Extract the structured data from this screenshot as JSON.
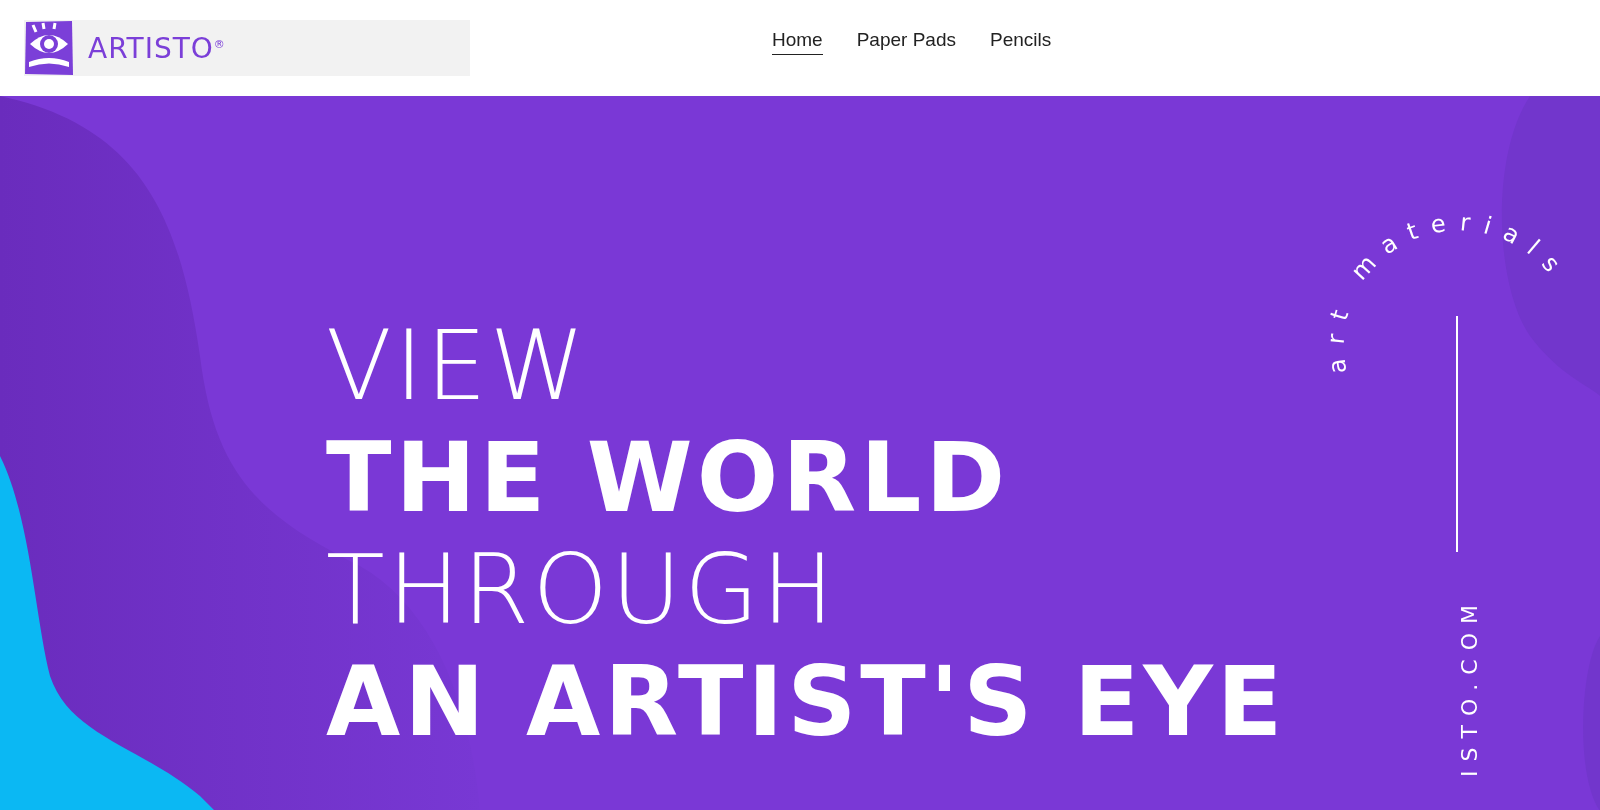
{
  "header": {
    "logo_text": "ARTISTO$^{®}$",
    "nav": [
      {
        "label": "Home",
        "selected": true
      },
      {
        "label": "Paper Pads",
        "selected": false
      },
      {
        "label": "Pencils",
        "selected": false
      }
    ]
  },
  "hero": {
    "headline": [
      {
        "text": "VIEW",
        "kind": "light"
      },
      {
        "text": "THE WORLD",
        "kind": "bold"
      },
      {
        "text": "THROUGH",
        "kind": "light"
      },
      {
        "text": "AN ARTIST'S EYE",
        "kind": "bold"
      }
    ],
    "arc_text": "art materials",
    "vertical_text": "ISTO.COM"
  }
}
